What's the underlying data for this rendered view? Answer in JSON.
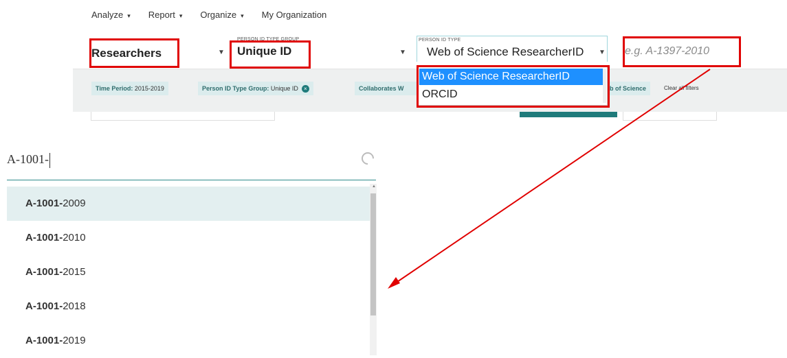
{
  "nav": {
    "items": [
      {
        "label": "Analyze",
        "caret": "▾"
      },
      {
        "label": "Report",
        "caret": "▾"
      },
      {
        "label": "Organize",
        "caret": "▾"
      },
      {
        "label": "My Organization",
        "caret": ""
      }
    ]
  },
  "fields": {
    "entity": {
      "value": "Researchers",
      "caret": "▼"
    },
    "id_group": {
      "label": "PERSON ID TYPE GROUP",
      "value": "Unique ID",
      "caret": "▼"
    },
    "id_type": {
      "label": "PERSON ID TYPE",
      "value": "Web of Science ResearcherID",
      "caret": "▼"
    },
    "id_input": {
      "placeholder": "e.g. A-1397-2010"
    }
  },
  "filters": {
    "chips": [
      {
        "key": "Time Period:",
        "value": "2015-2019",
        "removable": false
      },
      {
        "key": "Person ID Type Group:",
        "value": "Unique ID",
        "removable": true
      },
      {
        "key": "Collaborates W",
        "value": "",
        "removable": false
      },
      {
        "key": "",
        "value": "b of Science",
        "removable": false
      }
    ],
    "clear_label": "Clear all filters",
    "remove_glyph": "×"
  },
  "dropdown": {
    "options": [
      "Web of Science ResearcherID",
      "ORCID"
    ],
    "selected": "Web of Science ResearcherID"
  },
  "search": {
    "value": "A-1001-"
  },
  "suggestions": [
    {
      "prefix": "A-1001-",
      "suffix": "2009",
      "highlighted": true
    },
    {
      "prefix": "A-1001-",
      "suffix": "2010",
      "highlighted": false
    },
    {
      "prefix": "A-1001-",
      "suffix": "2015",
      "highlighted": false
    },
    {
      "prefix": "A-1001-",
      "suffix": "2018",
      "highlighted": false
    },
    {
      "prefix": "A-1001-",
      "suffix": "2019",
      "highlighted": false
    }
  ],
  "colors": {
    "annotation_red": "#e00000",
    "accent_teal": "#1f7b7b",
    "selected_blue": "#1e90ff"
  }
}
